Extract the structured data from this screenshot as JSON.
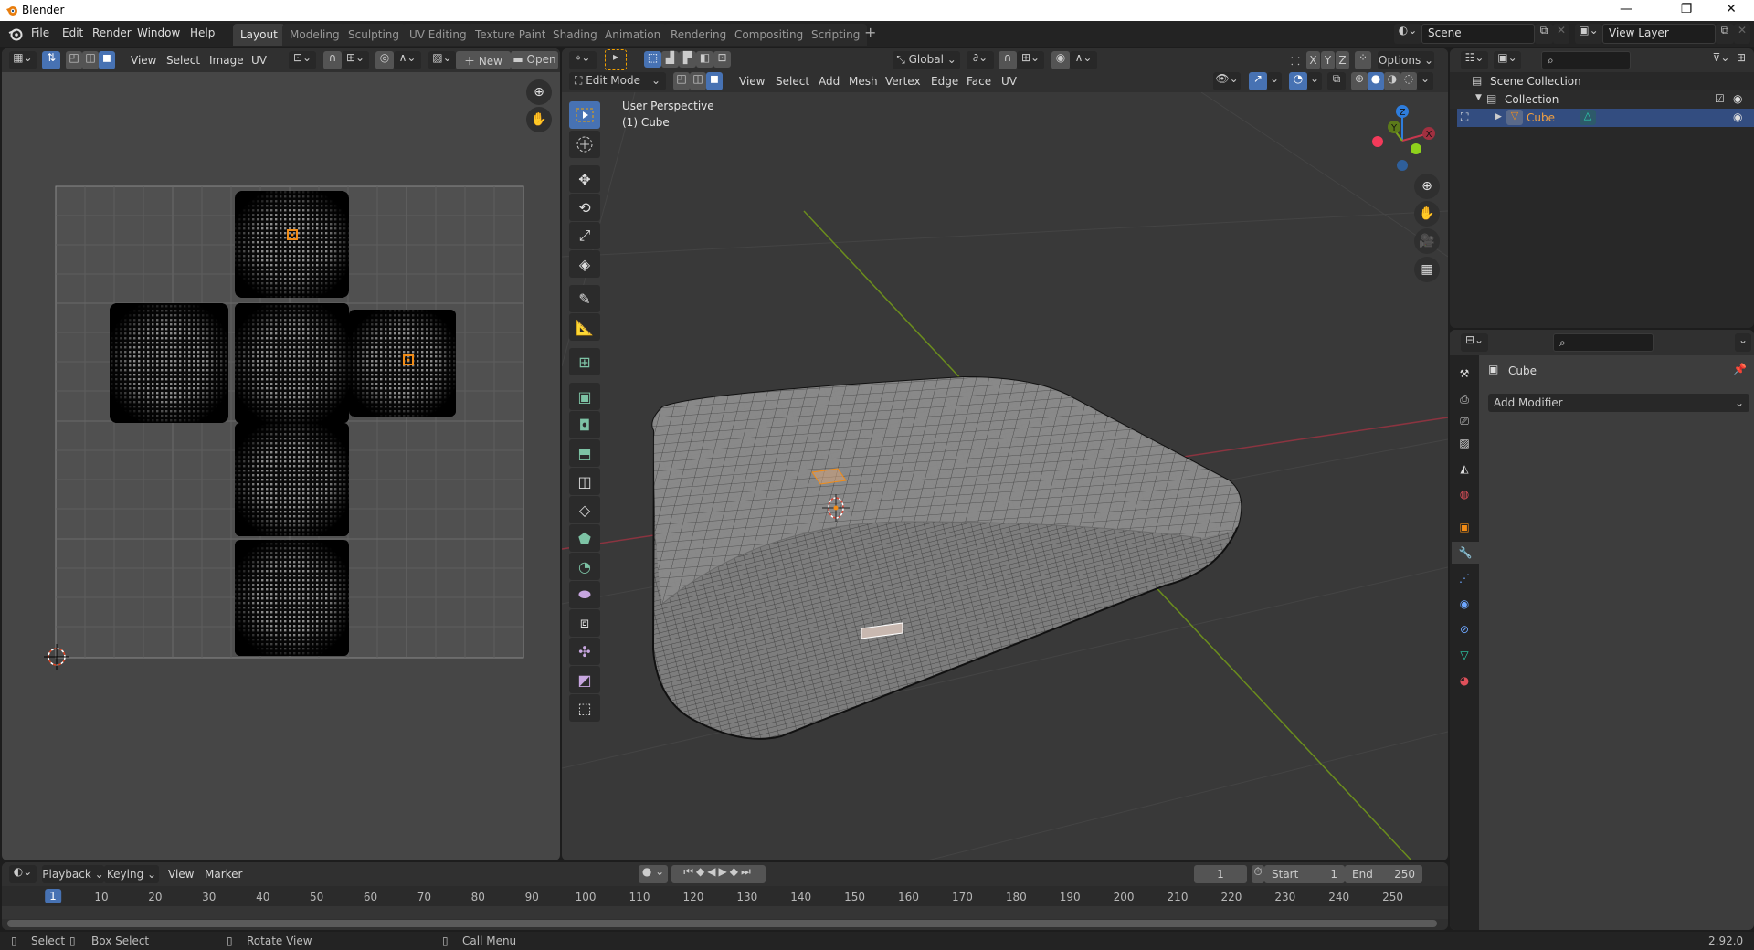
{
  "window": {
    "title": "Blender",
    "controls": {
      "minimize": "—",
      "maximize": "❐",
      "close": "✕"
    }
  },
  "topbar": {
    "menus": [
      "File",
      "Edit",
      "Render",
      "Window",
      "Help"
    ],
    "workspaces": [
      "Layout",
      "Modeling",
      "Sculpting",
      "UV Editing",
      "Texture Paint",
      "Shading",
      "Animation",
      "Rendering",
      "Compositing",
      "Scripting"
    ],
    "active_workspace": "Layout",
    "add_workspace": "+",
    "scene": "Scene",
    "view_layer": "View Layer"
  },
  "uv_editor": {
    "menus": [
      "View",
      "Select",
      "Image",
      "UV"
    ],
    "new_label": "New",
    "open_label": "Open",
    "icons": [
      "editor-type-icon",
      "sync-selection-icon",
      "vertex-select-icon",
      "edge-select-icon",
      "face-select-icon",
      "pivot-icon",
      "snap-icon",
      "proportional-icon",
      "image-browse-icon"
    ]
  },
  "viewport": {
    "mode": "Edit Mode",
    "menus": [
      "View",
      "Select",
      "Add",
      "Mesh",
      "Vertex",
      "Edge",
      "Face",
      "UV"
    ],
    "transform_orientation": "Global",
    "axis_buttons": [
      "X",
      "Y",
      "Z"
    ],
    "options_label": "Options",
    "overlay_title": "User Perspective",
    "overlay_object": "(1) Cube",
    "gizmo": {
      "x": "X",
      "y": "Y",
      "z": "Z"
    },
    "colors": {
      "x_axis": "#c6374e",
      "y_axis": "#7ca21f",
      "z_axis": "#2e7ddd",
      "select": "#f28c16"
    },
    "tools": [
      "select-box",
      "cursor",
      "move",
      "rotate",
      "scale",
      "transform",
      "annotate",
      "measure",
      "add-cube",
      "extrude",
      "inset",
      "bevel",
      "loop-cut",
      "knife",
      "poly-build",
      "spin",
      "smooth",
      "edge-slide",
      "shrink-fatten",
      "shear",
      "rip-region"
    ]
  },
  "outliner": {
    "items": [
      {
        "label": "Scene Collection",
        "level": 0
      },
      {
        "label": "Collection",
        "level": 1
      },
      {
        "label": "Cube",
        "level": 2,
        "selected": true
      }
    ]
  },
  "properties": {
    "object_name": "Cube",
    "add_modifier": "Add Modifier",
    "tabs": [
      "tool",
      "render",
      "output",
      "view-layer",
      "scene",
      "world",
      "object",
      "modifier",
      "particles",
      "physics",
      "constraints",
      "data",
      "material"
    ],
    "active_tab": "modifier"
  },
  "timeline": {
    "menus": [
      "Playback",
      "Keying",
      "View",
      "Marker"
    ],
    "current_frame": "1",
    "start_label": "Start",
    "start_value": "1",
    "end_label": "End",
    "end_value": "250",
    "ticks": [
      "1",
      "10",
      "20",
      "30",
      "40",
      "50",
      "60",
      "70",
      "80",
      "90",
      "100",
      "110",
      "120",
      "130",
      "140",
      "150",
      "160",
      "170",
      "180",
      "190",
      "200",
      "210",
      "220",
      "230",
      "240",
      "250"
    ]
  },
  "statusbar": {
    "select": "Select",
    "box_select": "Box Select",
    "rotate_view": "Rotate View",
    "call_menu": "Call Menu",
    "version": "2.92.0"
  }
}
